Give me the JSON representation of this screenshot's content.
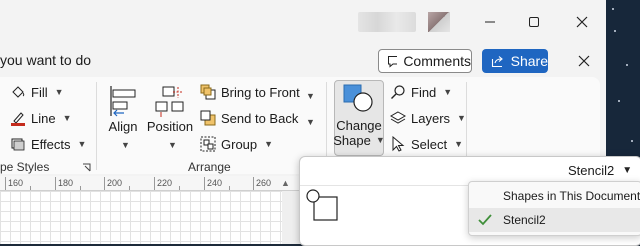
{
  "window": {
    "tell_me": "you want to do",
    "comments_label": "Comments",
    "share_label": "Share"
  },
  "ribbon": {
    "fill_label": "Fill",
    "line_label": "Line",
    "effects_label": "Effects",
    "shape_styles_label": "pe Styles",
    "align_label": "Align",
    "position_label": "Position",
    "bring_front_label": "Bring to Front",
    "send_back_label": "Send to Back",
    "group_label": "Group",
    "arrange_label": "Arrange",
    "change_shape_line1": "Change",
    "change_shape_line2": "Shape",
    "find_label": "Find",
    "layers_label": "Layers",
    "select_label": "Select"
  },
  "ruler": {
    "ticks": [
      "160",
      "180",
      "200",
      "220",
      "240",
      "260"
    ]
  },
  "panel": {
    "stencil_label": "Stencil2",
    "submenu": [
      {
        "label": "Shapes in This Document",
        "checked": false
      },
      {
        "label": "Stencil2",
        "checked": true
      }
    ]
  },
  "colors": {
    "accent": "#1f66c1",
    "line_red": "#c42b1c",
    "check_green": "#3f8f3a"
  }
}
